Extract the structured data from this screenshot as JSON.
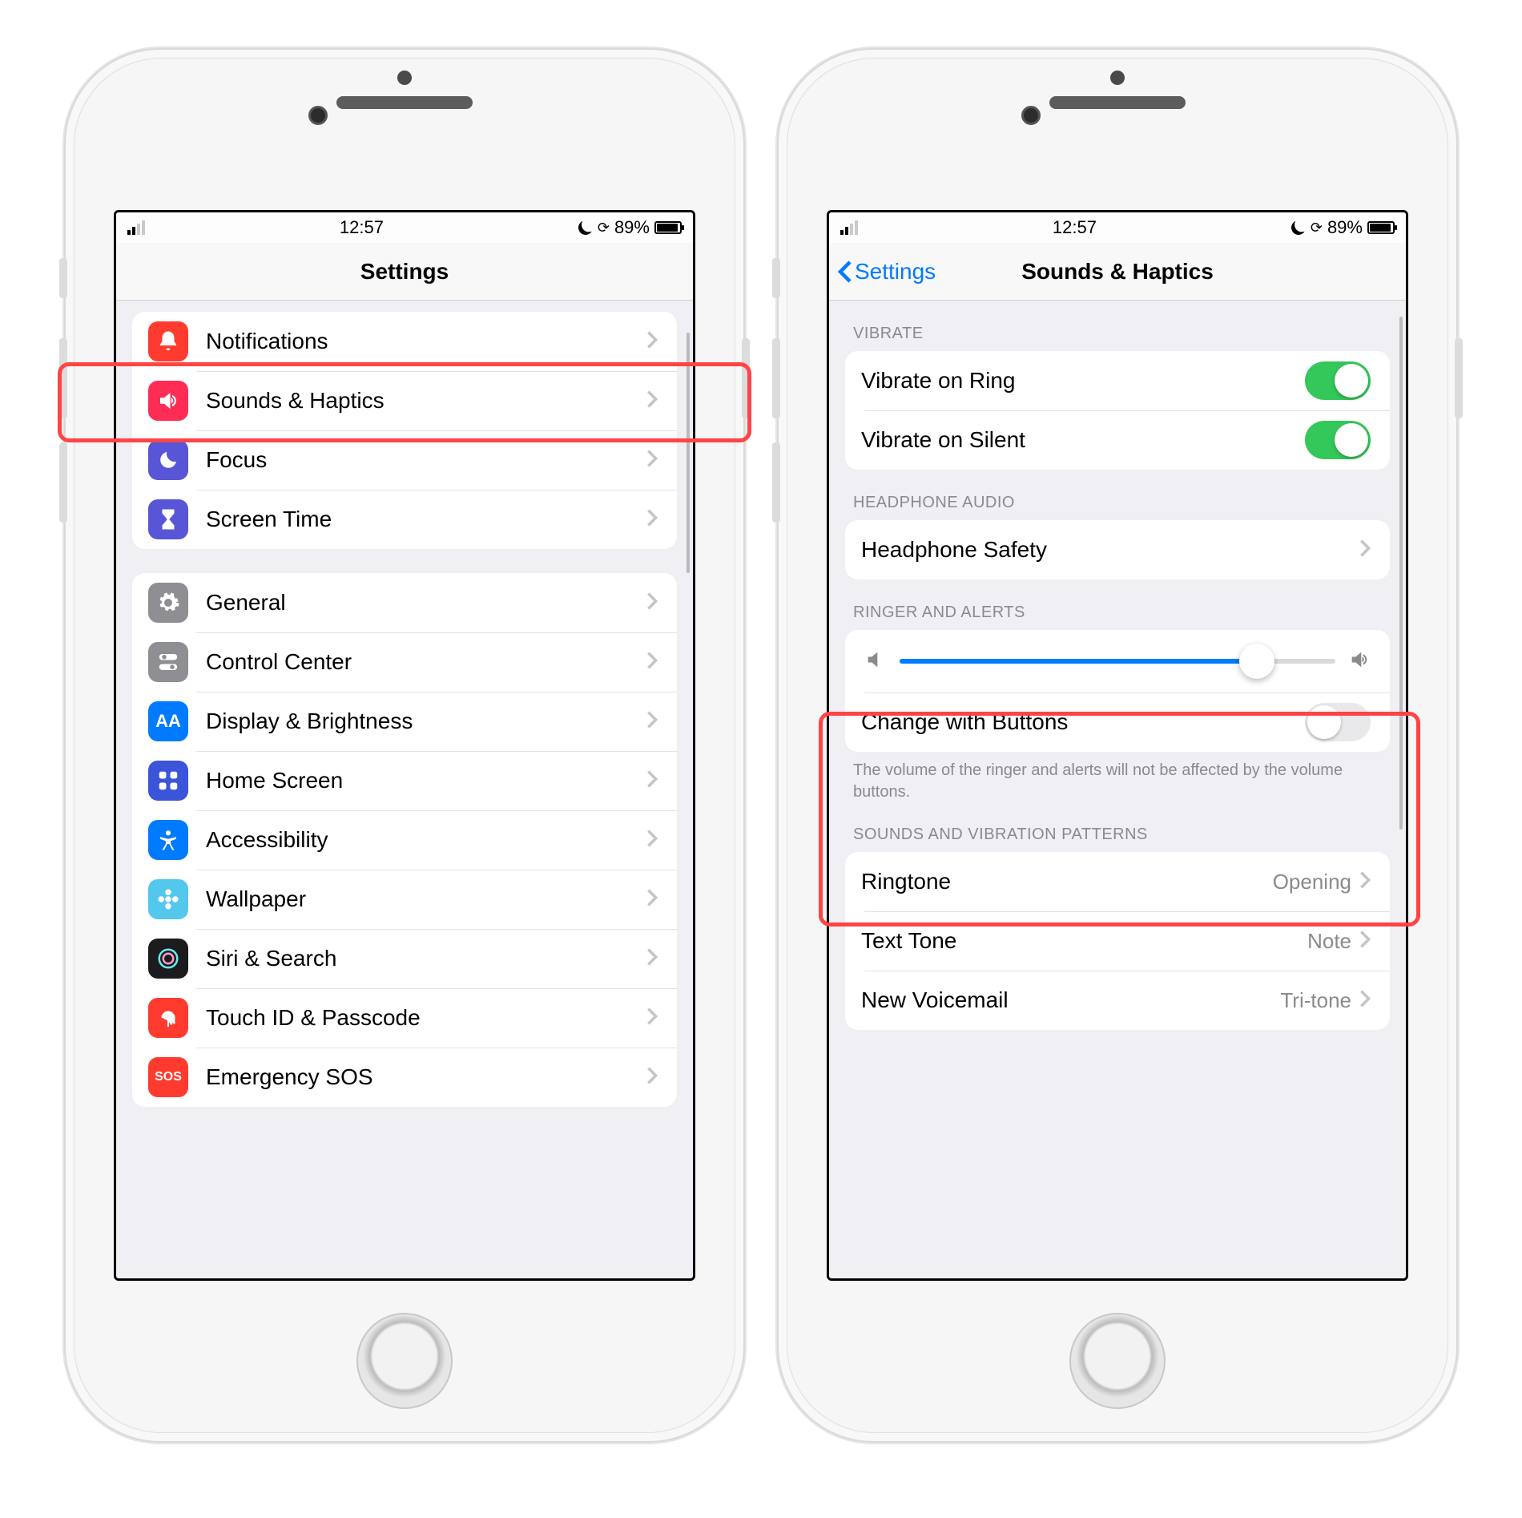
{
  "status": {
    "time": "12:57",
    "battery_pct": "89%"
  },
  "left": {
    "title": "Settings",
    "group1": [
      {
        "label": "Notifications"
      },
      {
        "label": "Sounds & Haptics"
      },
      {
        "label": "Focus"
      },
      {
        "label": "Screen Time"
      }
    ],
    "group2": [
      {
        "label": "General"
      },
      {
        "label": "Control Center"
      },
      {
        "label": "Display & Brightness"
      },
      {
        "label": "Home Screen"
      },
      {
        "label": "Accessibility"
      },
      {
        "label": "Wallpaper"
      },
      {
        "label": "Siri & Search"
      },
      {
        "label": "Touch ID & Passcode"
      },
      {
        "label": "Emergency SOS"
      }
    ]
  },
  "right": {
    "back": "Settings",
    "title": "Sounds & Haptics",
    "vibrate_header": "VIBRATE",
    "vibrate_ring": "Vibrate on Ring",
    "vibrate_silent": "Vibrate on Silent",
    "headphone_header": "HEADPHONE AUDIO",
    "headphone_safety": "Headphone Safety",
    "ringer_header": "RINGER AND ALERTS",
    "change_buttons": "Change with Buttons",
    "ringer_footer": "The volume of the ringer and alerts will not be affected by the volume buttons.",
    "patterns_header": "SOUNDS AND VIBRATION PATTERNS",
    "ringtone_label": "Ringtone",
    "ringtone_value": "Opening",
    "texttone_label": "Text Tone",
    "texttone_value": "Note",
    "voicemail_label": "New Voicemail",
    "voicemail_value": "Tri-tone",
    "slider_pct": 82
  },
  "icons": {
    "notifications": "bell-icon",
    "sounds": "speaker-icon",
    "focus": "moon-icon",
    "screentime": "hourglass-icon",
    "general": "gear-icon",
    "control_center": "toggles-icon",
    "display": "aa-icon",
    "homescreen": "grid-icon",
    "accessibility": "person-icon",
    "wallpaper": "flower-icon",
    "siri": "siri-icon",
    "touchid": "fingerprint-icon",
    "emergency": "sos-icon"
  },
  "colors": {
    "notifications": "#ff3b30",
    "sounds": "#ff2d55",
    "focus": "#5856d6",
    "screentime": "#5856d6",
    "general": "#8e8e93",
    "control_center": "#8e8e93",
    "display": "#007aff",
    "homescreen": "#3355dd",
    "accessibility": "#007aff",
    "wallpaper": "#54c7ec",
    "siri": "#1c1c1e",
    "touchid": "#ff3b30",
    "emergency": "#ff3b30"
  }
}
